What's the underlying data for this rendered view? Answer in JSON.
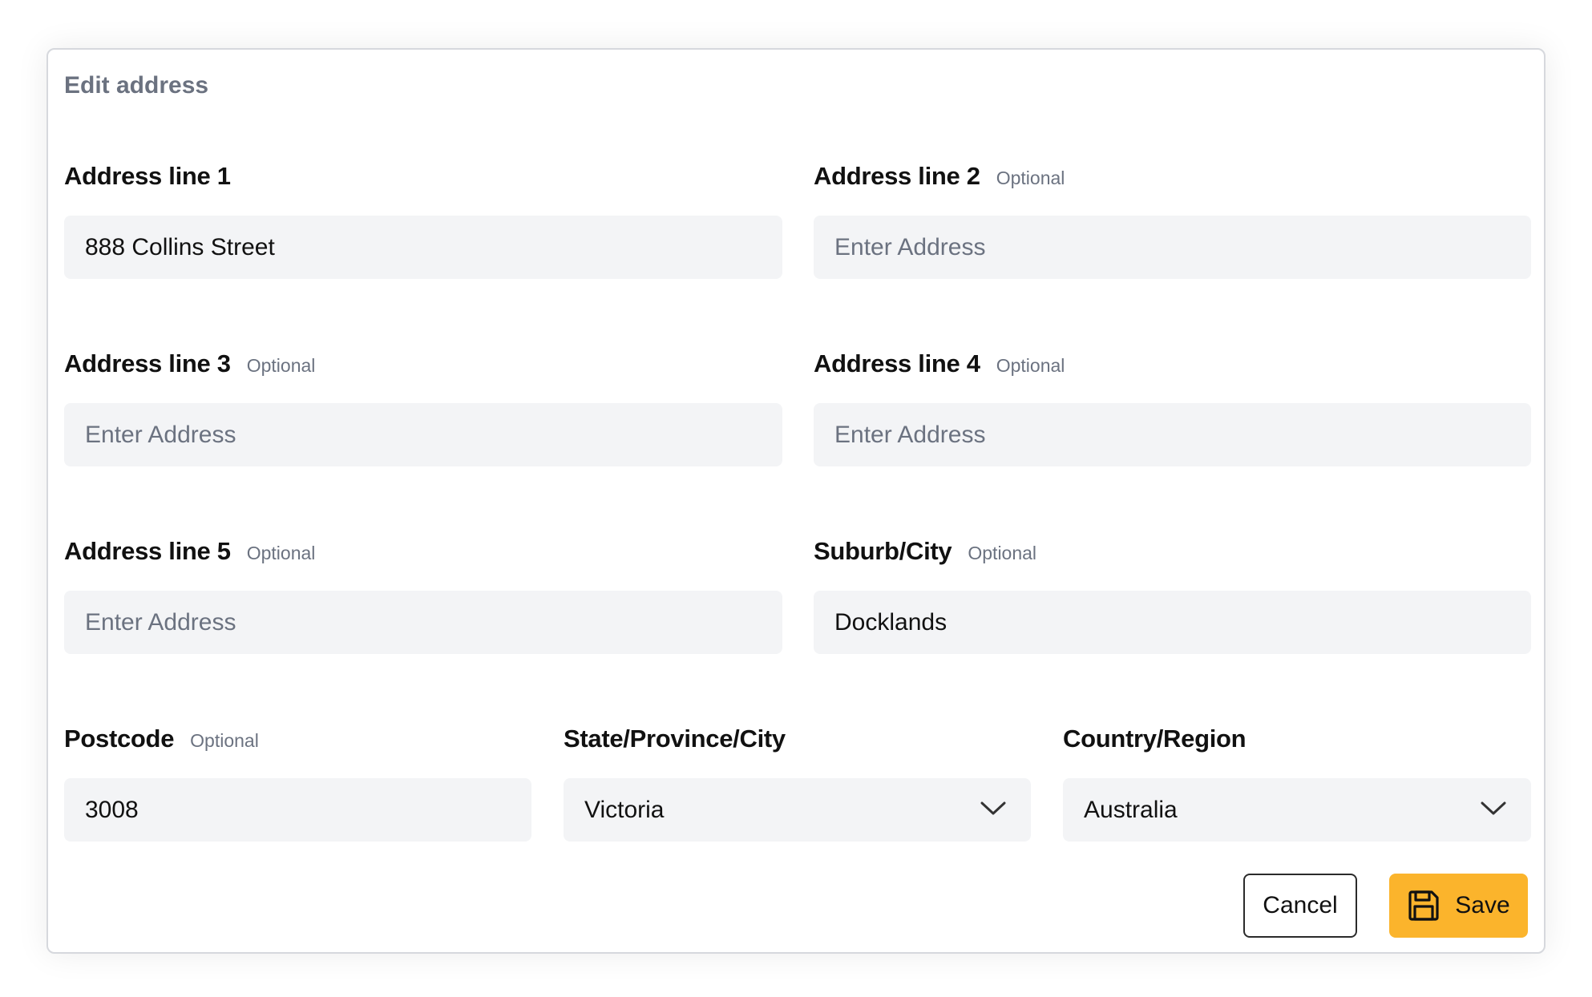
{
  "form": {
    "title": "Edit address",
    "fields": [
      {
        "label": "Address line 1",
        "optional": "",
        "value": "888 Collins Street",
        "placeholder": ""
      },
      {
        "label": "Address line 2",
        "optional": "Optional",
        "value": "",
        "placeholder": "Enter Address"
      },
      {
        "label": "Address line 3",
        "optional": "Optional",
        "value": "",
        "placeholder": "Enter Address"
      },
      {
        "label": "Address line 4",
        "optional": "Optional",
        "value": "",
        "placeholder": "Enter Address"
      },
      {
        "label": "Address line 5",
        "optional": "Optional",
        "value": "",
        "placeholder": "Enter Address"
      },
      {
        "label": "Suburb/City",
        "optional": "Optional",
        "value": "Docklands",
        "placeholder": ""
      },
      {
        "label": "Postcode",
        "optional": "Optional",
        "value": "3008",
        "placeholder": ""
      },
      {
        "label": "State/Province/City",
        "optional": "",
        "value": "Victoria",
        "placeholder": ""
      },
      {
        "label": "Country/Region",
        "optional": "",
        "value": "Australia",
        "placeholder": ""
      }
    ],
    "cancel_label": "Cancel",
    "save_label": "Save"
  },
  "icons": {
    "dropdown": "chevron-down-icon",
    "save": "floppy-disk-icon"
  },
  "colors": {
    "input_bg": "#f3f4f6",
    "save_button": "#fbb42c",
    "muted_text": "#6b7280"
  }
}
